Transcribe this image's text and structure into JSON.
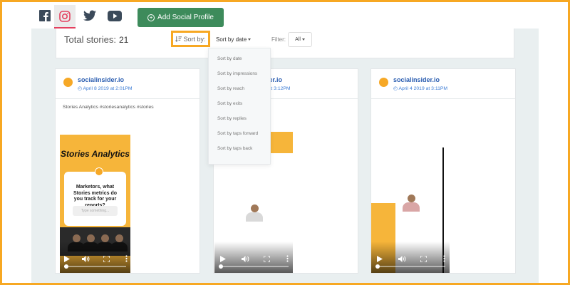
{
  "topbar": {
    "networks": [
      {
        "name": "facebook",
        "icon": "facebook-icon",
        "active": false
      },
      {
        "name": "instagram",
        "icon": "instagram-icon",
        "active": true
      },
      {
        "name": "twitter",
        "icon": "twitter-icon",
        "active": false
      },
      {
        "name": "youtube",
        "icon": "youtube-icon",
        "active": false
      }
    ],
    "add_profile_label": "Add Social Profile"
  },
  "header": {
    "total_label": "Total stories:",
    "total_count": "21",
    "sort_by_label": "Sort by:",
    "sort_selected": "Sort by date",
    "filter_label": "Filter:",
    "filter_selected": "All"
  },
  "sort_menu": {
    "options": [
      "Sort by date",
      "Sort by impressions",
      "Sort by reach",
      "Sort by exits",
      "Sort by replies",
      "Sort by taps forward",
      "Sort by taps back"
    ]
  },
  "stories": [
    {
      "account": "socialinsider.io",
      "date": "April 8 2019 at 2:01PM",
      "caption": "Stories Analytics #storiesanalytics #stories",
      "story_title": "Stories Analytics",
      "story_question": "Marketors, what Stories metrics do you track for your reports?",
      "story_input_placeholder": "Type something..."
    },
    {
      "account": "socialinsider.io",
      "date": "April 8 2019 at 3:12PM"
    },
    {
      "account": "socialinsider.io",
      "date": "April 4 2019 at 3:11PM"
    }
  ],
  "colors": {
    "highlight": "#f7a823",
    "brand_green": "#3d8b5b",
    "instagram": "#e4405f",
    "link_blue": "#2a5db0",
    "story_yellow": "#f6b53a"
  }
}
